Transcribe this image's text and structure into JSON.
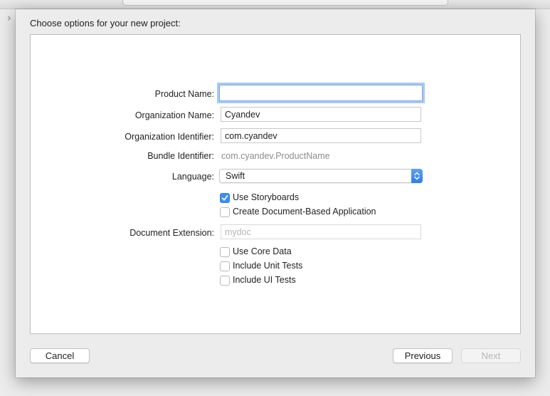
{
  "window": {
    "back_icon": "chevron-right-icon"
  },
  "sheet": {
    "title": "Choose options for your new project:"
  },
  "form": {
    "product_name": {
      "label": "Product Name:",
      "value": ""
    },
    "organization_name": {
      "label": "Organization Name:",
      "value": "Cyandev"
    },
    "organization_identifier": {
      "label": "Organization Identifier:",
      "value": "com.cyandev"
    },
    "bundle_identifier": {
      "label": "Bundle Identifier:",
      "value": "com.cyandev.ProductName"
    },
    "language": {
      "label": "Language:",
      "selected": "Swift"
    },
    "use_storyboards": {
      "label": "Use Storyboards",
      "checked": true
    },
    "document_based": {
      "label": "Create Document-Based Application",
      "checked": false
    },
    "document_extension": {
      "label": "Document Extension:",
      "placeholder": "mydoc"
    },
    "use_core_data": {
      "label": "Use Core Data",
      "checked": false
    },
    "unit_tests": {
      "label": "Include Unit Tests",
      "checked": false
    },
    "ui_tests": {
      "label": "Include UI Tests",
      "checked": false
    }
  },
  "buttons": {
    "cancel": "Cancel",
    "previous": "Previous",
    "next": "Next"
  },
  "colors": {
    "accent": "#3b8ef5",
    "focus_ring": "#a9c8f3"
  }
}
